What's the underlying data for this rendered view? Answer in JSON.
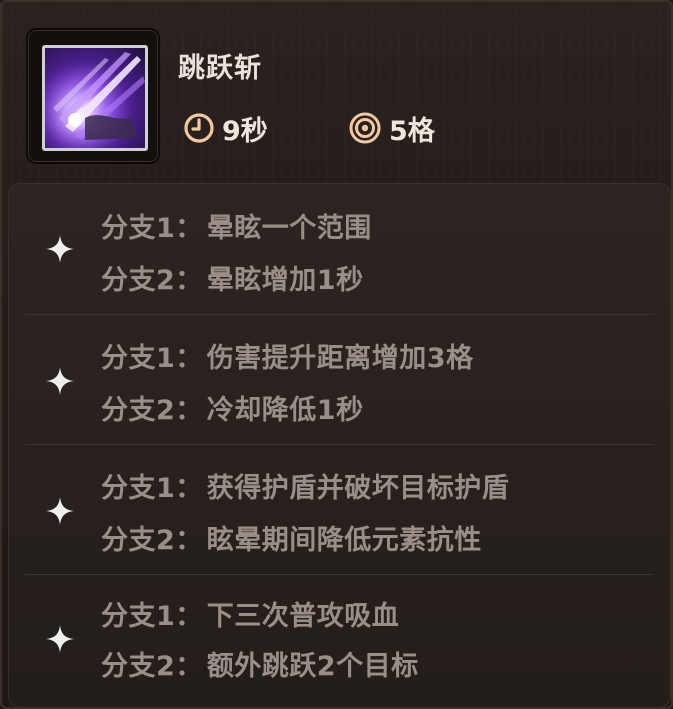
{
  "skill": {
    "name": "跳跃斩",
    "icon": "purple-slash-skill-icon",
    "cooldown": "9秒",
    "range": "5格"
  },
  "branches": [
    {
      "branch1_label": "分支1：",
      "branch1_text": "晕眩一个范围",
      "branch2_label": "分支2：",
      "branch2_text": "晕眩增加1秒"
    },
    {
      "branch1_label": "分支1：",
      "branch1_text": "伤害提升距离增加3格",
      "branch2_label": "分支2：",
      "branch2_text": "冷却降低1秒"
    },
    {
      "branch1_label": "分支1：",
      "branch1_text": "获得护盾并破坏目标护盾",
      "branch2_label": "分支2：",
      "branch2_text": "眩晕期间降低元素抗性"
    },
    {
      "branch1_label": "分支1：",
      "branch1_text": "下三次普攻吸血",
      "branch2_label": "分支2：",
      "branch2_text": "额外跳跃2个目标"
    }
  ],
  "colors": {
    "title": "#e9e2da",
    "branch_text": "#9a8f86",
    "stat_icon": "#f2c7a3",
    "skill_glow": "#8a4fe0"
  }
}
